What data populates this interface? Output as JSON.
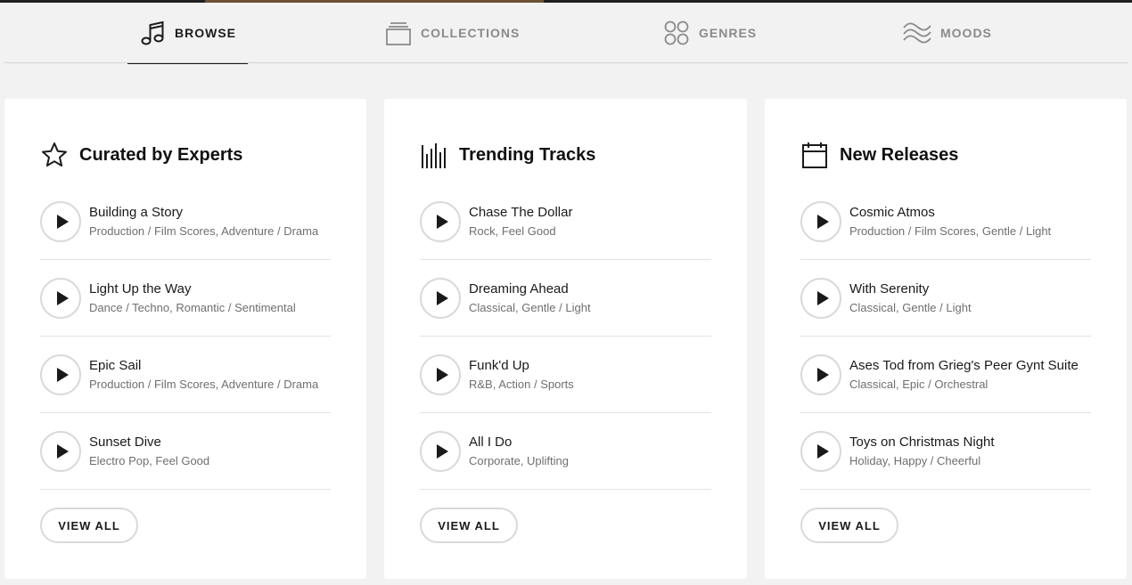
{
  "nav": {
    "tabs": [
      {
        "label": "BROWSE",
        "icon": "music-note-icon",
        "active": true
      },
      {
        "label": "COLLECTIONS",
        "icon": "stack-icon",
        "active": false
      },
      {
        "label": "GENRES",
        "icon": "circles-grid-icon",
        "active": false
      },
      {
        "label": "MOODS",
        "icon": "waves-icon",
        "active": false
      }
    ]
  },
  "cards": [
    {
      "title": "Curated by Experts",
      "icon": "star-icon",
      "tracks": [
        {
          "title": "Building a Story",
          "tags": "Production / Film Scores, Adventure / Drama"
        },
        {
          "title": "Light Up the Way",
          "tags": "Dance / Techno, Romantic / Sentimental"
        },
        {
          "title": "Epic Sail",
          "tags": "Production / Film Scores, Adventure / Drama"
        },
        {
          "title": "Sunset Dive",
          "tags": "Electro Pop, Feel Good"
        }
      ],
      "view_all": "VIEW ALL"
    },
    {
      "title": "Trending Tracks",
      "icon": "bars-icon",
      "tracks": [
        {
          "title": "Chase The Dollar",
          "tags": "Rock, Feel Good"
        },
        {
          "title": "Dreaming Ahead",
          "tags": "Classical, Gentle / Light"
        },
        {
          "title": "Funk'd Up",
          "tags": "R&B, Action / Sports"
        },
        {
          "title": "All I Do",
          "tags": "Corporate, Uplifting"
        }
      ],
      "view_all": "VIEW ALL"
    },
    {
      "title": "New Releases",
      "icon": "calendar-icon",
      "tracks": [
        {
          "title": "Cosmic Atmos",
          "tags": "Production / Film Scores, Gentle / Light"
        },
        {
          "title": "With Serenity",
          "tags": "Classical, Gentle / Light"
        },
        {
          "title": "Ases Tod from Grieg's Peer Gynt Suite",
          "tags": "Classical, Epic / Orchestral"
        },
        {
          "title": "Toys on Christmas Night",
          "tags": "Holiday, Happy / Cheerful"
        }
      ],
      "view_all": "VIEW ALL"
    }
  ],
  "colors": {
    "accent": "#1a1a1a",
    "inactive": "#8a8a8a",
    "background": "#f2f2f2",
    "card": "#ffffff"
  }
}
